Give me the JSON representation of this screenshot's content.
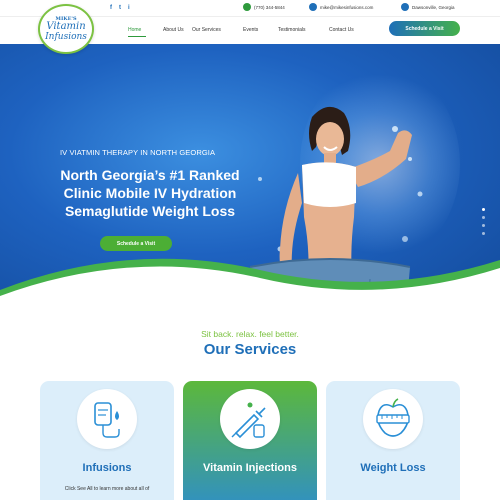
{
  "topbar": {
    "social": [
      "f",
      "t",
      "i"
    ],
    "phone": "(770) 344-5844",
    "email": "mike@mikesinfusions.com",
    "location": "Dawsonville, Georgia"
  },
  "logo": {
    "line1": "MIKE'S",
    "line2": "Vitamin",
    "line3": "Infusions"
  },
  "nav": {
    "items": [
      "Home",
      "About Us",
      "Our Services",
      "Events",
      "Testimonials",
      "Contact Us"
    ],
    "active": "Home",
    "cta": "Schedule a Visit"
  },
  "hero": {
    "kicker": "IV VIATMIN THERAPY IN NORTH GEORGIA",
    "headline": "North Georgia’s #1 Ranked Clinic Mobile IV Hydration Semaglutide Weight Loss",
    "cta": "Schedule a Visit"
  },
  "services": {
    "tagline": "Sit back. relax. feel better.",
    "title": "Our Services",
    "cards": [
      {
        "title": "Infusions",
        "desc": "Click See All to learn more about all of",
        "icon": "iv-bag-icon"
      },
      {
        "title": "Vitamin Injections",
        "icon": "syringe-icon"
      },
      {
        "title": "Weight Loss",
        "icon": "apple-measuring-tape-icon"
      }
    ]
  },
  "colors": {
    "brand_blue": "#1f6fb8",
    "brand_green": "#7cc242",
    "accent_green": "#4cae35"
  }
}
